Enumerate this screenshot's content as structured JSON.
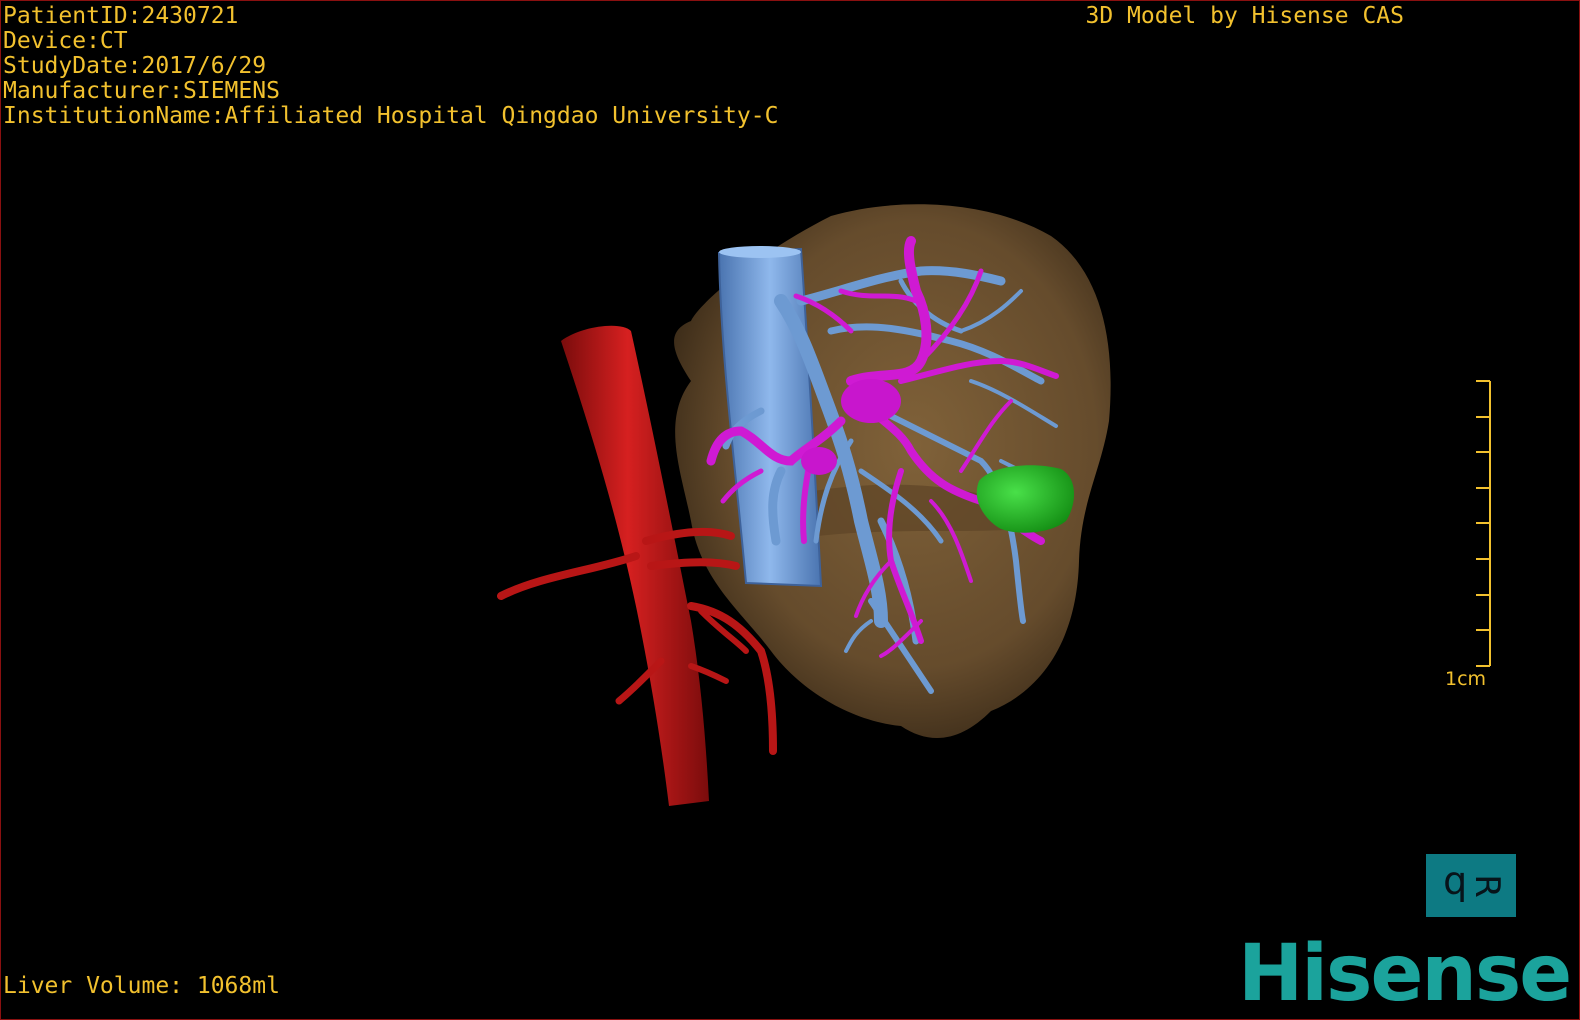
{
  "overlay": {
    "patient_id": "PatientID:2430721",
    "device": "Device:CT",
    "study_date": "StudyDate:2017/6/29",
    "manufacturer": "Manufacturer:SIEMENS",
    "institution": "InstitutionName:Affiliated Hospital Qingdao University-C",
    "model_credit": "3D Model by Hisense CAS",
    "liver_volume": "Liver Volume: 1068ml"
  },
  "scale": {
    "label": "1cm"
  },
  "orientation_cube": {
    "left_face": "d",
    "right_face": "R"
  },
  "brand": {
    "logo_text": "Hisense"
  },
  "colors": {
    "overlay_text": "#f2c12e",
    "liver": "#7a5a32",
    "hepatic_artery_aorta": "#c01818",
    "vena_cava_portal": "#6f9fd8",
    "hepatic_vein": "#d21ad6",
    "lesion": "#1fbf1f",
    "brand": "#1ba39c"
  },
  "icons": [
    "orientation-cube-icon",
    "hisense-logo"
  ]
}
